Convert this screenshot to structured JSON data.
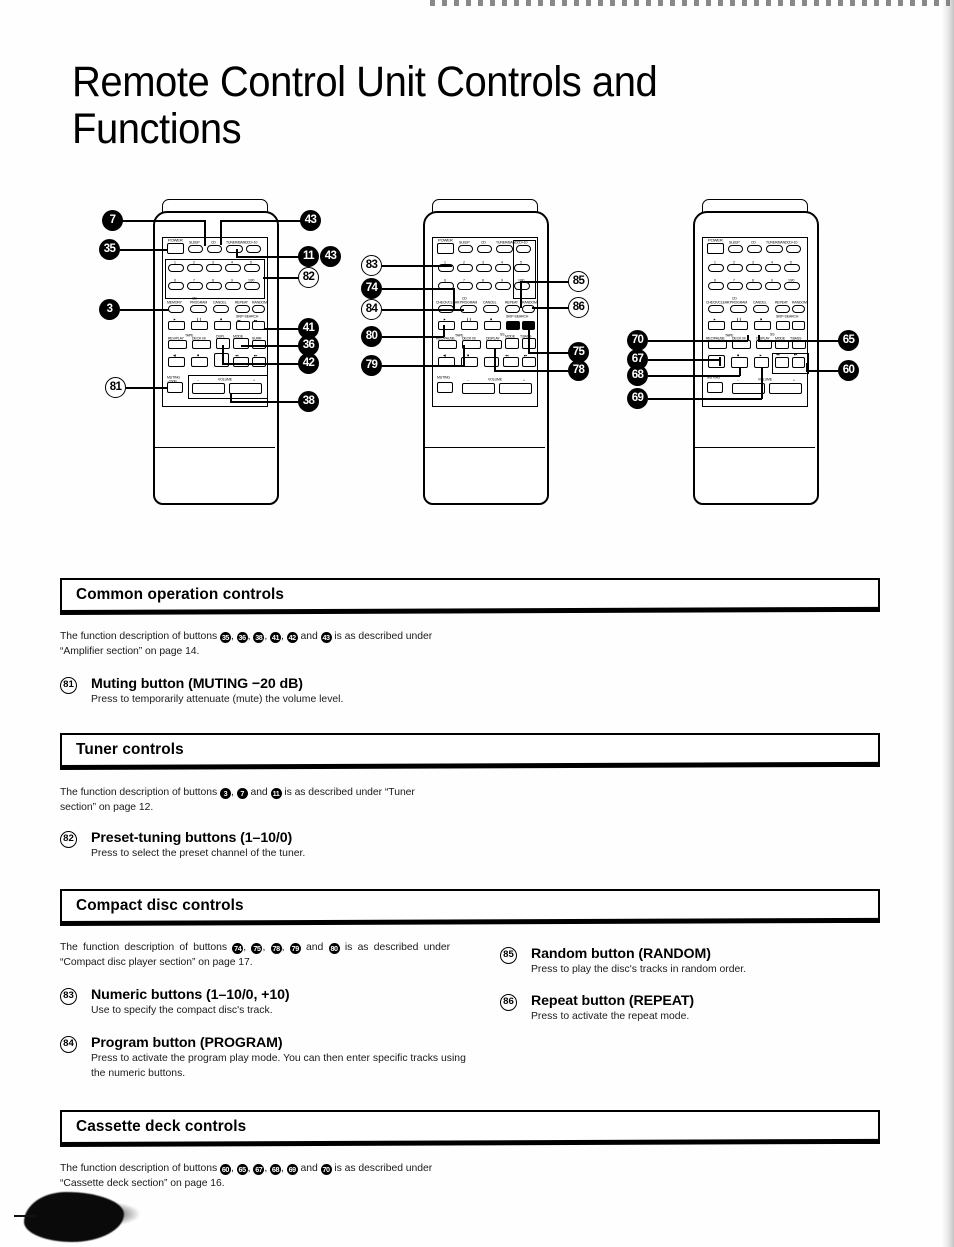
{
  "page": {
    "title": "Remote Control Unit Controls and Functions"
  },
  "diagrams": {
    "caption": "three remote control unit illustrations with numbered callouts",
    "remote1": {
      "name": "remote-control-unit-1",
      "callouts_left": [
        "7",
        "35",
        "3",
        "81"
      ],
      "callouts_right": [
        "43",
        "11",
        "43",
        "82",
        "41",
        "36",
        "42",
        "38"
      ],
      "button_labels": [
        "POWER",
        "SLEEP",
        "CD",
        "TUNER/BAND",
        "CD+10",
        "1",
        "2",
        "3",
        "4",
        "5",
        "6",
        "7",
        "8",
        "9",
        "10/0",
        "MEMORY",
        "PROGRAM",
        "CANCEL",
        "REPEAT",
        "RANDOM",
        "CD",
        "TAPE",
        "TUNER",
        "REV/PLAY",
        "DECK I/II",
        "DISPLAY",
        "SURR",
        "SKIP-SEARCH",
        "MUTING -20dB",
        "VOLUME"
      ]
    },
    "remote2": {
      "name": "remote-control-unit-2",
      "callouts_left": [
        "83",
        "74",
        "84",
        "80",
        "79"
      ],
      "callouts_right": [
        "85",
        "86",
        "75",
        "78"
      ],
      "button_labels": [
        "POWER",
        "SLEEP",
        "CD",
        "TUNER/BAND",
        "CD+10",
        "1",
        "2",
        "3",
        "4",
        "5",
        "6",
        "7",
        "8",
        "9",
        "10/0",
        "CHECK/CLEAR",
        "PROGRAM",
        "CANCEL",
        "REPEAT",
        "RANDOM",
        "CD",
        "TAPE",
        "SKIP-SEARCH",
        "REC/PAUSE",
        "DECK I/II",
        "DISPLAY",
        "MODE",
        "T.BASS",
        "VOLUME"
      ]
    },
    "remote3": {
      "name": "remote-control-unit-3",
      "callouts_left": [
        "70",
        "67",
        "68",
        "69"
      ],
      "callouts_right": [
        "65",
        "60"
      ],
      "button_labels": [
        "POWER",
        "SLEEP",
        "CD",
        "TUNER/BAND",
        "CD+10",
        "1",
        "2",
        "3",
        "4",
        "5",
        "6",
        "7",
        "8",
        "9",
        "10/0",
        "CHECK/CLEAR",
        "PROGRAM",
        "CANCEL",
        "REPEAT",
        "RANDOM",
        "TAPE",
        "CD",
        "SKIP-SEARCH",
        "REC/PAUSE",
        "DECK I/II",
        "DISPLAY",
        "MODE",
        "T.BASS",
        "VOLUME"
      ]
    }
  },
  "sections": [
    {
      "id": "common",
      "heading": "Common operation controls",
      "intro_prefix": "The function description of buttons ",
      "intro_buttons": [
        "35",
        "36",
        "38",
        "41",
        "42",
        "43"
      ],
      "intro_suffix": " is as described under “Amplifier section” on page 14.",
      "entries": [
        {
          "num": "81",
          "head": "Muting button (MUTING −20 dB)",
          "body": "Press to temporarily attenuate (mute) the volume level."
        }
      ],
      "entries_right": []
    },
    {
      "id": "tuner",
      "heading": "Tuner controls",
      "intro_prefix": "The function description of buttons ",
      "intro_buttons": [
        "3",
        "7",
        "11"
      ],
      "intro_suffix": " is as described under “Tuner section” on page 12.",
      "entries": [
        {
          "num": "82",
          "head": "Preset-tuning buttons (1–10/0)",
          "body": "Press to select the preset channel of the tuner."
        }
      ],
      "entries_right": []
    },
    {
      "id": "cd",
      "heading": "Compact disc controls",
      "intro_prefix": "The function description of buttons ",
      "intro_buttons": [
        "74",
        "75",
        "78",
        "79",
        "80"
      ],
      "intro_suffix": " is as described under “Compact disc player section” on page 17.",
      "entries": [
        {
          "num": "83",
          "head": "Numeric buttons (1–10/0, +10)",
          "body": "Use to specify the compact disc's track."
        },
        {
          "num": "84",
          "head": "Program button (PROGRAM)",
          "body": "Press to activate the program play mode. You can then enter specific tracks using the numeric buttons."
        }
      ],
      "entries_right": [
        {
          "num": "85",
          "head": "Random button (RANDOM)",
          "body": "Press to play the disc's tracks in random order."
        },
        {
          "num": "86",
          "head": "Repeat button (REPEAT)",
          "body": "Press to activate the repeat mode."
        }
      ]
    },
    {
      "id": "cassette",
      "heading": "Cassette deck controls",
      "intro_prefix": "The function description of buttons ",
      "intro_buttons": [
        "60",
        "65",
        "67",
        "68",
        "69",
        "70"
      ],
      "intro_suffix": " is as described under “Cassette deck section” on page 16.",
      "entries": [],
      "entries_right": []
    }
  ]
}
